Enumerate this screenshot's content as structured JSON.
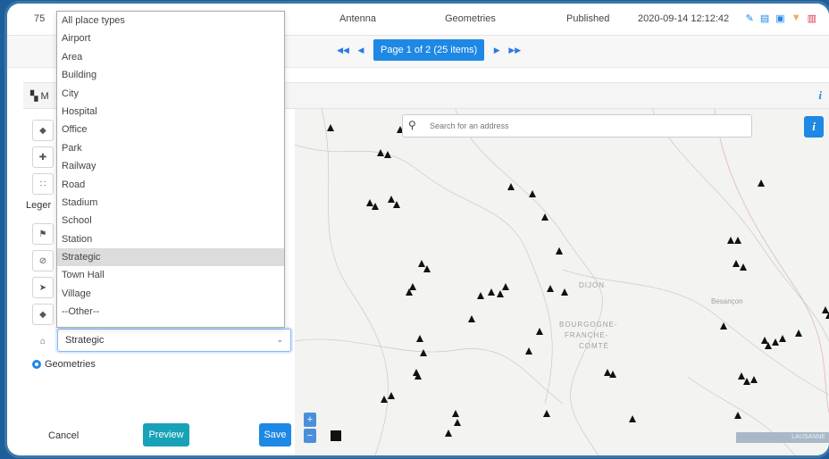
{
  "table_row": {
    "id": "75",
    "type": "Antenna",
    "category": "Geometries",
    "status": "Published",
    "timestamp": "2020-09-14 12:12:42",
    "action_icons": [
      "edit-icon",
      "clipboard-icon",
      "save-icon",
      "thumbs-down-icon",
      "trash-icon"
    ]
  },
  "pager": {
    "first": "◀◀",
    "prev": "◀",
    "current": "Page 1 of 2 (25 items)",
    "next": "▶",
    "last": "▶▶"
  },
  "panel": {
    "title": "M",
    "info": "i"
  },
  "left": {
    "legend_label": "Leger",
    "place_type_select": "Strategic",
    "geometries_radio": "Geometries",
    "cancel": "Cancel",
    "preview": "Preview",
    "save": "Save"
  },
  "dropdown_options": [
    "All place types",
    "Airport",
    "Area",
    "Building",
    "City",
    "Hospital",
    "Office",
    "Park",
    "Railway",
    "Road",
    "Stadium",
    "School",
    "Station",
    "Strategic",
    "Town Hall",
    "Village",
    "--Other--"
  ],
  "selected_option": "Strategic",
  "map": {
    "search_placeholder": "Search for an address",
    "info": "i",
    "zoom_in": "+",
    "zoom_out": "−",
    "label_dijon": "DIJON",
    "label_region_1": "BOURGOGNE-",
    "label_region_2": "FRANCHE-",
    "label_region_3": "COMTÉ",
    "label_besancon": "Besançon",
    "label_lausanne": "LAUSANNE"
  },
  "colors": {
    "accent": "#1e88e5",
    "preview": "#17a2b8",
    "frame_bg": "#1d5f9b"
  }
}
